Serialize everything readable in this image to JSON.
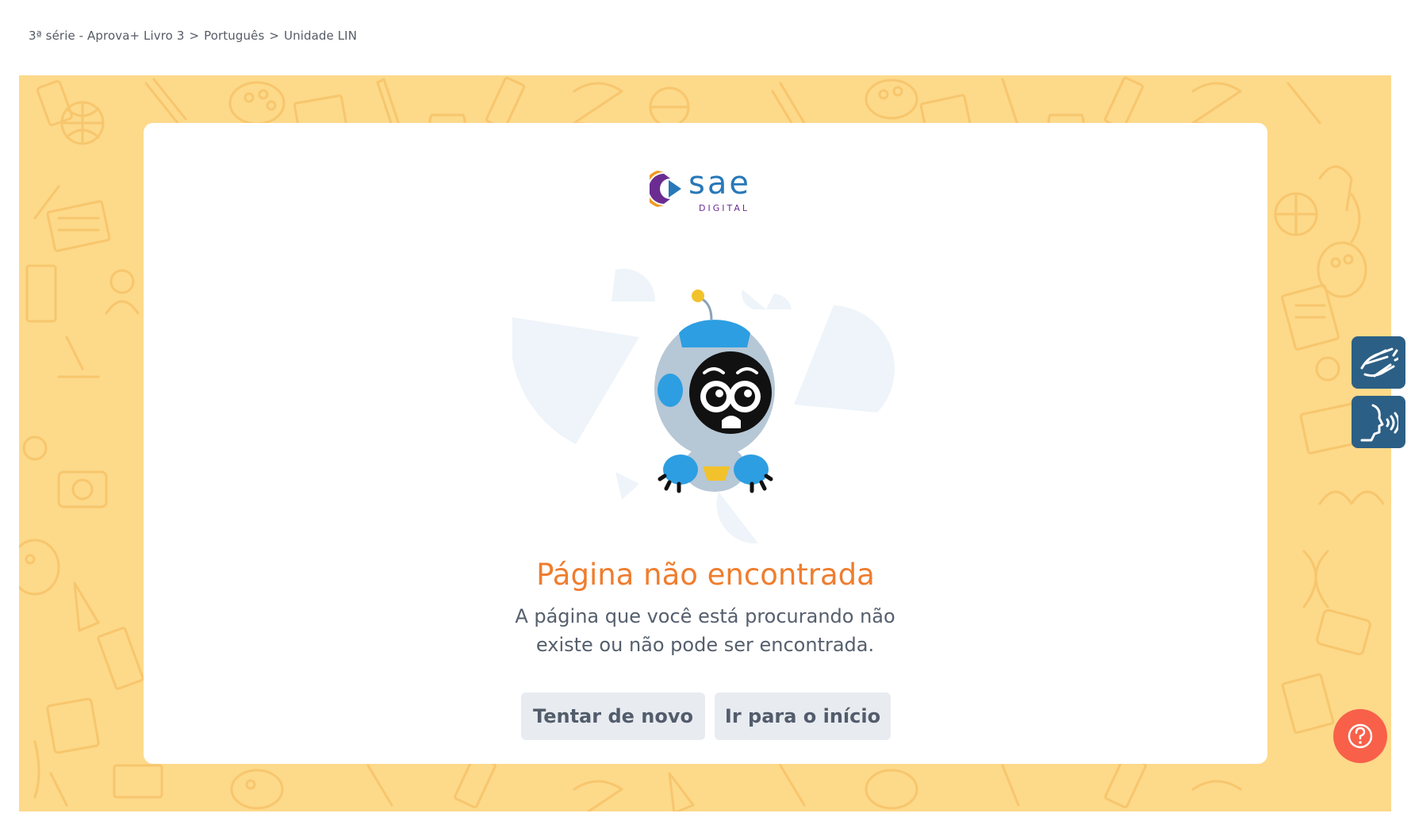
{
  "breadcrumb": {
    "items": [
      "3ª série - Aprova+ Livro 3",
      "Português",
      "Unidade LIN"
    ],
    "separator": ">"
  },
  "logo": {
    "word": "sae",
    "sub": "DIGITAL",
    "icon": "sae-logo-icon"
  },
  "error": {
    "title": "Página não encontrada",
    "description_line1": "A página que você está procurando não",
    "description_line2": "existe ou não pode ser encontrada.",
    "illustration": "sad-robot-illustration"
  },
  "actions": {
    "retry_label": "Tentar de novo",
    "home_label": "Ir para o início"
  },
  "side_tools": [
    {
      "name": "libras-icon",
      "label": "Libras"
    },
    {
      "name": "speech-icon",
      "label": "Leitor de voz"
    }
  ],
  "help": {
    "icon": "help-question-icon"
  },
  "colors": {
    "banner": "#fdd98a",
    "title": "#ef7d2f",
    "button_bg": "#e8ecf1",
    "side_button": "#2c5f85",
    "help_button": "#f86049",
    "logo_blue": "#2878b8",
    "logo_purple": "#6a2c91"
  }
}
